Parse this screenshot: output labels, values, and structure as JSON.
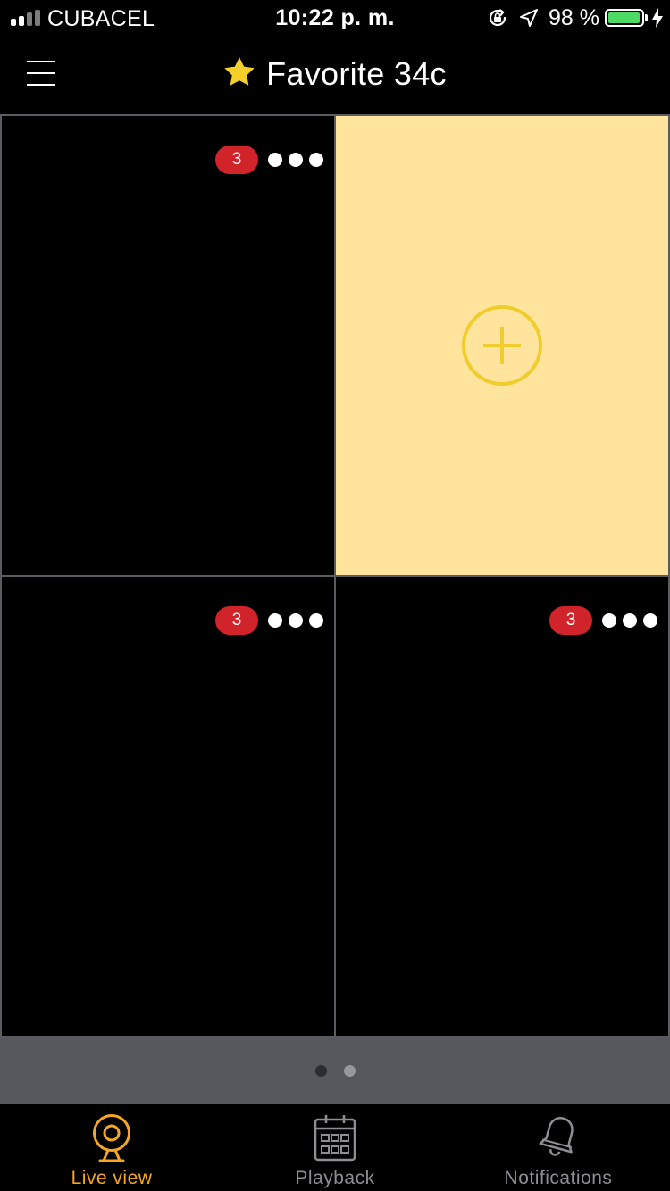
{
  "status_bar": {
    "carrier": "CUBACEL",
    "time": "10:22 p. m.",
    "battery_percent": "98 %",
    "battery_level": 0.98,
    "signal_bars": 4,
    "signal_bars_filled": 2,
    "icons": [
      "orientation-lock-icon",
      "location-arrow-icon",
      "battery-icon",
      "charging-bolt-icon"
    ]
  },
  "nav": {
    "title": "Favorite 34c",
    "menu_icon": "hamburger-menu-icon",
    "title_icon": "star-icon",
    "star_color": "#f5cf2b"
  },
  "grid": {
    "cells": [
      {
        "name": "camera-slot-1",
        "state": "camera",
        "badge_count": "3"
      },
      {
        "name": "camera-slot-2",
        "state": "empty"
      },
      {
        "name": "camera-slot-3",
        "state": "camera",
        "badge_count": "3"
      },
      {
        "name": "camera-slot-4",
        "state": "camera",
        "badge_count": "3"
      }
    ],
    "empty_slot_color": "#ffe49d",
    "add_icon": "add-circle-icon",
    "add_color": "#f0cd2c",
    "badge_color": "#d1232a"
  },
  "pager": {
    "pages": 2,
    "current": 1,
    "active_color": "#2c2d30",
    "inactive_color": "#97989c"
  },
  "tabs": [
    {
      "label": "Live view",
      "icon": "webcam-icon",
      "active": true
    },
    {
      "label": "Playback",
      "icon": "calendar-icon",
      "active": false
    },
    {
      "label": "Notifications",
      "icon": "bell-icon",
      "active": false
    }
  ],
  "colors": {
    "accent": "#f5a623",
    "tab_inactive": "#8e8e93",
    "grid_divider": "#5b5c60"
  }
}
